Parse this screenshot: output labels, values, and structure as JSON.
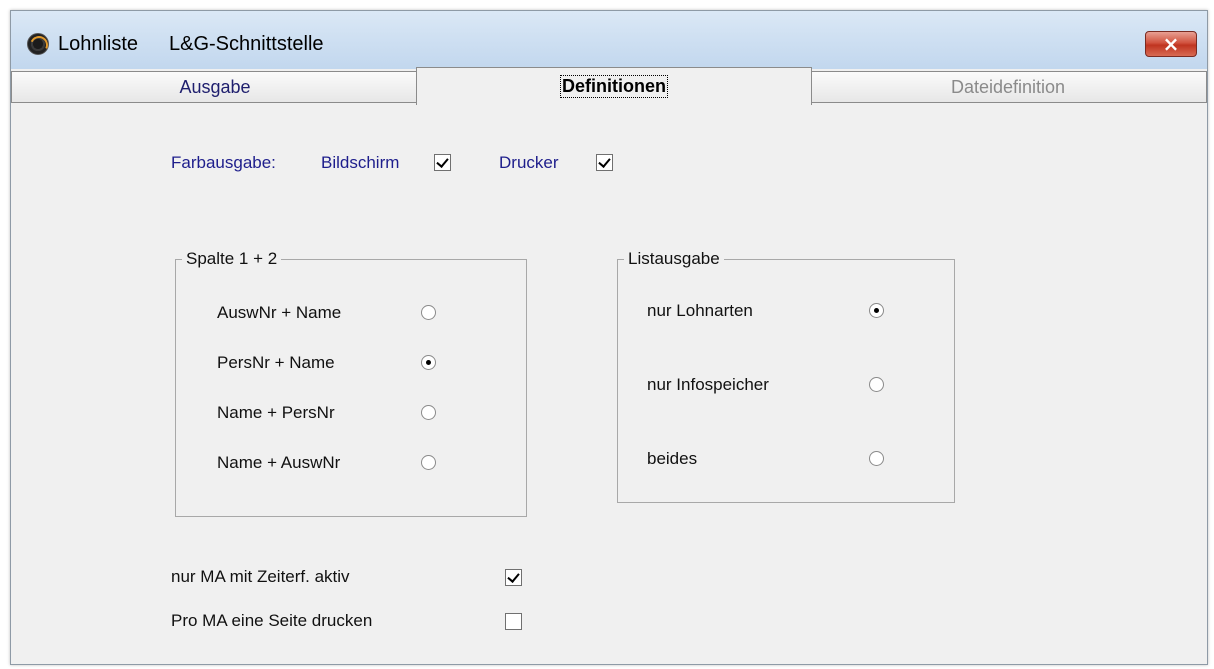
{
  "window": {
    "app_name": "Lohnliste",
    "doc_title": "L&G-Schnittstelle",
    "close_glyph": "×"
  },
  "tabs": [
    {
      "label": "Ausgabe",
      "state": "normal"
    },
    {
      "label": "Definitionen",
      "state": "active"
    },
    {
      "label": "Dateidefinition",
      "state": "disabled"
    }
  ],
  "color_output": {
    "label": "Farbausgabe:",
    "screen_label": "Bildschirm",
    "screen_checked": true,
    "printer_label": "Drucker",
    "printer_checked": true
  },
  "column_group": {
    "title": "Spalte 1 + 2",
    "options": [
      {
        "label": "AuswNr + Name",
        "selected": false
      },
      {
        "label": "PersNr + Name",
        "selected": true
      },
      {
        "label": "Name + PersNr",
        "selected": false
      },
      {
        "label": "Name + AuswNr",
        "selected": false
      }
    ]
  },
  "list_group": {
    "title": "Listausgabe",
    "options": [
      {
        "label": "nur Lohnarten",
        "selected": true
      },
      {
        "label": "nur Infospeicher",
        "selected": false
      },
      {
        "label": "beides",
        "selected": false
      }
    ]
  },
  "options": {
    "active_only_label": "nur MA mit Zeiterf. aktiv",
    "active_only_checked": true,
    "page_per_employee_label": "Pro MA eine Seite drucken",
    "page_per_employee_checked": false
  },
  "colors": {
    "label_blue": "#1e1e8c",
    "title_gradient_top": "#dbe8f6",
    "close_red": "#c03420",
    "panel_bg": "#f0f0f0"
  }
}
